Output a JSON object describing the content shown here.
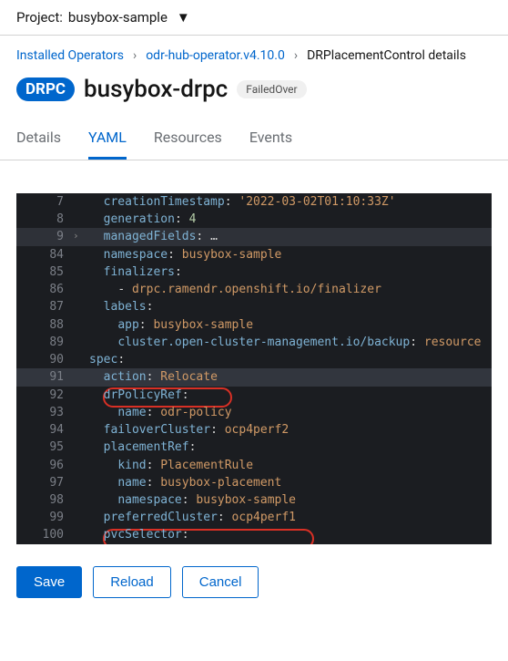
{
  "project": {
    "label": "Project:",
    "name": "busybox-sample"
  },
  "breadcrumb": {
    "a": "Installed Operators",
    "b": "odr-hub-operator.v4.10.0",
    "c": "DRPlacementControl details"
  },
  "header": {
    "tag": "DRPC",
    "title": "busybox-drpc",
    "status": "FailedOver"
  },
  "tabs": {
    "details": "Details",
    "yaml": "YAML",
    "resources": "Resources",
    "events": "Events"
  },
  "code": {
    "l7": {
      "n": "7",
      "k": "creationTimestamp",
      "v": "'2022-03-02T01:10:33Z'"
    },
    "l8": {
      "n": "8",
      "k": "generation",
      "v": "4"
    },
    "l9": {
      "n": "9",
      "k": "managedFields",
      "v": "…"
    },
    "l84": {
      "n": "84",
      "k": "namespace",
      "v": "busybox-sample"
    },
    "l85": {
      "n": "85",
      "k": "finalizers"
    },
    "l86": {
      "n": "86",
      "v": "drpc.ramendr.openshift.io/finalizer"
    },
    "l87": {
      "n": "87",
      "k": "labels"
    },
    "l88": {
      "n": "88",
      "k": "app",
      "v": "busybox-sample"
    },
    "l89": {
      "n": "89",
      "k": "cluster.open-cluster-management.io/backup",
      "v": "resource"
    },
    "l90": {
      "n": "90",
      "k": "spec"
    },
    "l91": {
      "n": "91",
      "k": "action",
      "v": "Relocate"
    },
    "l92": {
      "n": "92",
      "k": "drPolicyRef"
    },
    "l93": {
      "n": "93",
      "k": "name",
      "v": "odr-policy"
    },
    "l94": {
      "n": "94",
      "k": "failoverCluster",
      "v": "ocp4perf2"
    },
    "l95": {
      "n": "95",
      "k": "placementRef"
    },
    "l96": {
      "n": "96",
      "k": "kind",
      "v": "PlacementRule"
    },
    "l97": {
      "n": "97",
      "k": "name",
      "v": "busybox-placement"
    },
    "l98": {
      "n": "98",
      "k": "namespace",
      "v": "busybox-sample"
    },
    "l99": {
      "n": "99",
      "k": "preferredCluster",
      "v": "ocp4perf1"
    },
    "l100": {
      "n": "100",
      "k": "pvcSelector"
    }
  },
  "buttons": {
    "save": "Save",
    "reload": "Reload",
    "cancel": "Cancel"
  }
}
